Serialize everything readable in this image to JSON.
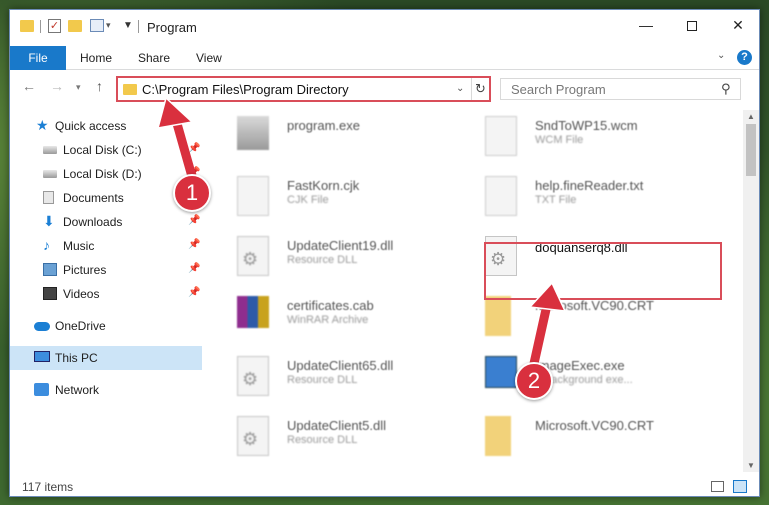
{
  "window": {
    "title": "Program"
  },
  "ribbon": {
    "tabs": [
      "File",
      "Home",
      "Share",
      "View"
    ]
  },
  "navbar": {
    "address": "C:\\Program Files\\Program Directory",
    "search_placeholder": "Search Program"
  },
  "sidebar": {
    "items": [
      {
        "label": "Quick access",
        "icon": "star-icon",
        "pinned": false
      },
      {
        "label": "Local Disk (C:)",
        "icon": "disk-icon",
        "pinned": true
      },
      {
        "label": "Local Disk (D:)",
        "icon": "disk-icon",
        "pinned": true
      },
      {
        "label": "Documents",
        "icon": "documents-icon",
        "pinned": true
      },
      {
        "label": "Downloads",
        "icon": "download-icon",
        "pinned": true
      },
      {
        "label": "Music",
        "icon": "music-icon",
        "pinned": true
      },
      {
        "label": "Pictures",
        "icon": "pictures-icon",
        "pinned": true
      },
      {
        "label": "Videos",
        "icon": "videos-icon",
        "pinned": true
      },
      {
        "label": "OneDrive",
        "icon": "cloud-icon",
        "pinned": false
      },
      {
        "label": "This PC",
        "icon": "computer-icon",
        "pinned": false,
        "selected": true
      },
      {
        "label": "Network",
        "icon": "network-icon",
        "pinned": false
      }
    ]
  },
  "files": [
    {
      "name": "program.exe",
      "type": "",
      "icon": "program-icon"
    },
    {
      "name": "SndToWP15.wcm",
      "type": "WCM File",
      "icon": "blank-file-icon"
    },
    {
      "name": "FastKorn.cjk",
      "type": "CJK File",
      "icon": "blank-file-icon"
    },
    {
      "name": "help.fineReader.txt",
      "type": "TXT File",
      "icon": "blank-file-icon"
    },
    {
      "name": "UpdateClient19.dll",
      "type": "Resource DLL",
      "icon": "dll-icon"
    },
    {
      "name": "doquanserq8.dll",
      "type": "",
      "icon": "dll-icon"
    },
    {
      "name": "certificates.cab",
      "type": "WinRAR Archive",
      "icon": "rar-icon"
    },
    {
      "name": "Microsoft.VC90.CRT",
      "type": "",
      "icon": "folder-icon"
    },
    {
      "name": "UpdateClient65.dll",
      "type": "Resource DLL",
      "icon": "dll-icon"
    },
    {
      "name": "ImageExec.exe",
      "type": "Y background exe...",
      "icon": "exe-icon"
    },
    {
      "name": "UpdateClient5.dll",
      "type": "Resource DLL",
      "icon": "dll-icon"
    },
    {
      "name": "Microsoft.VC90.CRT",
      "type": "",
      "icon": "folder-icon"
    }
  ],
  "status": {
    "item_count": "117 items"
  },
  "annotations": {
    "step1": "1",
    "step2": "2"
  },
  "colors": {
    "accent": "#1979ca",
    "highlight": "#d94d59",
    "callout": "#d9303e",
    "selection": "#cce4f7"
  }
}
